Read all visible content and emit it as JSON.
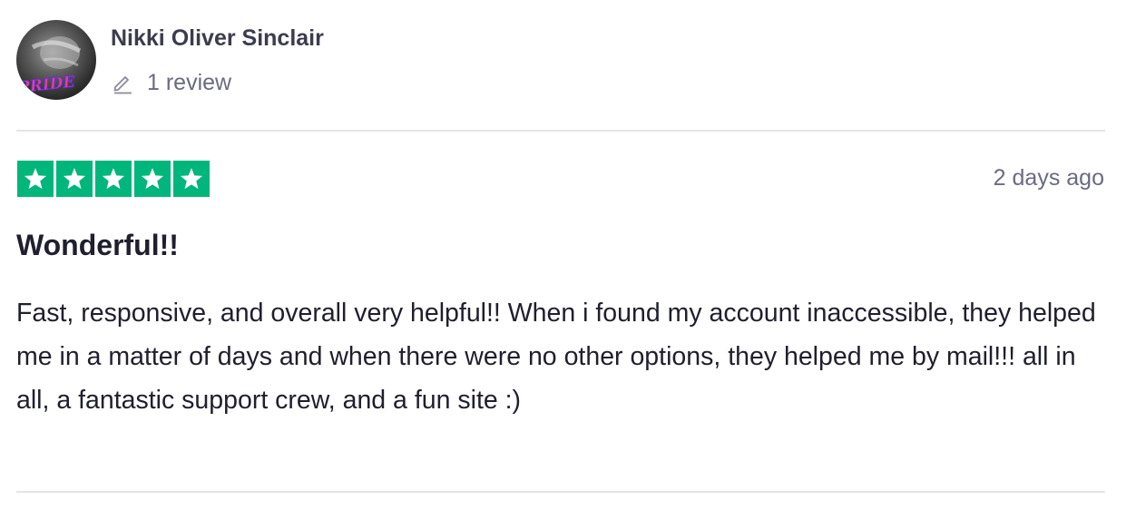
{
  "reviewer": {
    "name": "Nikki Oliver Sinclair",
    "review_count_text": "1 review",
    "avatar_text": "PRIDE"
  },
  "review": {
    "rating": 5,
    "rating_max": 5,
    "date": "2 days ago",
    "title": "Wonderful!!",
    "body": "Fast, responsive, and overall very helpful!! When i found my account inaccessible, they helped me in a matter of days and when there were no other options, they helped me by mail!!! all in all, a fantastic support crew, and a fun site :)"
  },
  "icons": {
    "pencil": "pencil-icon",
    "star": "star-icon"
  },
  "colors": {
    "star_green": "#00b67a",
    "muted_text": "#6b6b80",
    "divider": "#e5e5e8"
  }
}
